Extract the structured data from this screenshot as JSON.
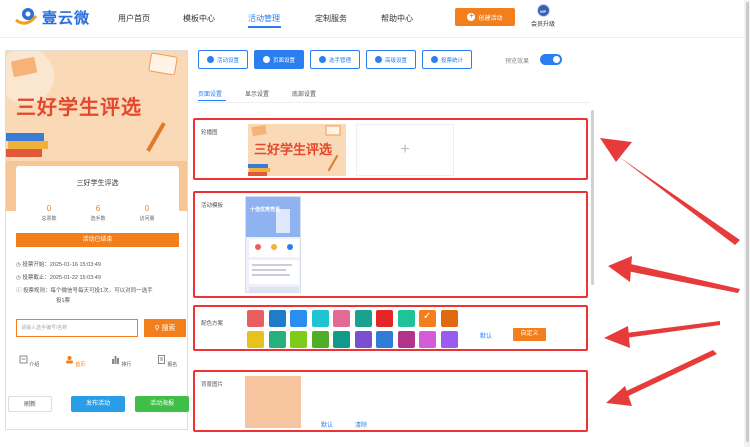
{
  "brand": {
    "name": "壹云微"
  },
  "nav": {
    "items": [
      "用户首页",
      "模板中心",
      "活动管理",
      "定制服务",
      "帮助中心"
    ],
    "active_index": 2,
    "create_label": "创建活动",
    "vip_badge": "VIP",
    "vip_label": "会员升级"
  },
  "preview": {
    "banner_title": "三好学生评选",
    "card_title": "三好学生评选",
    "stats": [
      {
        "value": "0",
        "label": "总票数"
      },
      {
        "value": "6",
        "label": "选手数"
      },
      {
        "value": "0",
        "label": "访问量"
      }
    ],
    "status_label": "活动已结束",
    "start_time": "投票开始：2025-01-16 15:03:49",
    "end_time": "投票截止：2025-01-22 15:03:49",
    "rule_line1": "投票规则：每个微信号每天可投1次，可以对同一选手",
    "rule_line2": "投1票",
    "search_placeholder": "请输入选手编号/名称",
    "search_button": "搜索",
    "tabs": [
      "介绍",
      "首页",
      "排行",
      "报名"
    ],
    "active_tab": 1
  },
  "actions": {
    "refresh": "刷新",
    "publish": "发布活动",
    "poster": "活动海报"
  },
  "toolbar": {
    "buttons": [
      "活动设置",
      "页面设置",
      "选手管理",
      "高级设置",
      "投票统计"
    ],
    "active_index": 1,
    "preview_label": "预览效果",
    "preview_on": true
  },
  "subtabs": [
    "页面设置",
    "显示设置",
    "底部设置"
  ],
  "sections": {
    "carousel_label": "轮播图",
    "carousel_title": "三好学生评选",
    "carousel_add": "+",
    "template_label": "活动模板",
    "template_preview_title": "十佳优秀党员",
    "color_label": "配色方案",
    "colors_row1": [
      "#e95f5f",
      "#1e7cc8",
      "#2a8ef0",
      "#1ec4d2",
      "#e36a95",
      "#1aa28e",
      "#e32626",
      "#1fc39a",
      "#f27e1c",
      "#e06a10"
    ],
    "colors_row2": [
      "#e8c11a",
      "#27b17a",
      "#7fcb1c",
      "#4fae28",
      "#0f9a8c",
      "#7c4fd0",
      "#2f7dd6",
      "#b0348c",
      "#d55cd8",
      "#9a5cf0"
    ],
    "selected_color": "#f27e1c",
    "default_label": "默认",
    "custom_label": "自定义",
    "bg_label": "背景图片",
    "bg_default": "默认",
    "bg_clear": "清除"
  }
}
